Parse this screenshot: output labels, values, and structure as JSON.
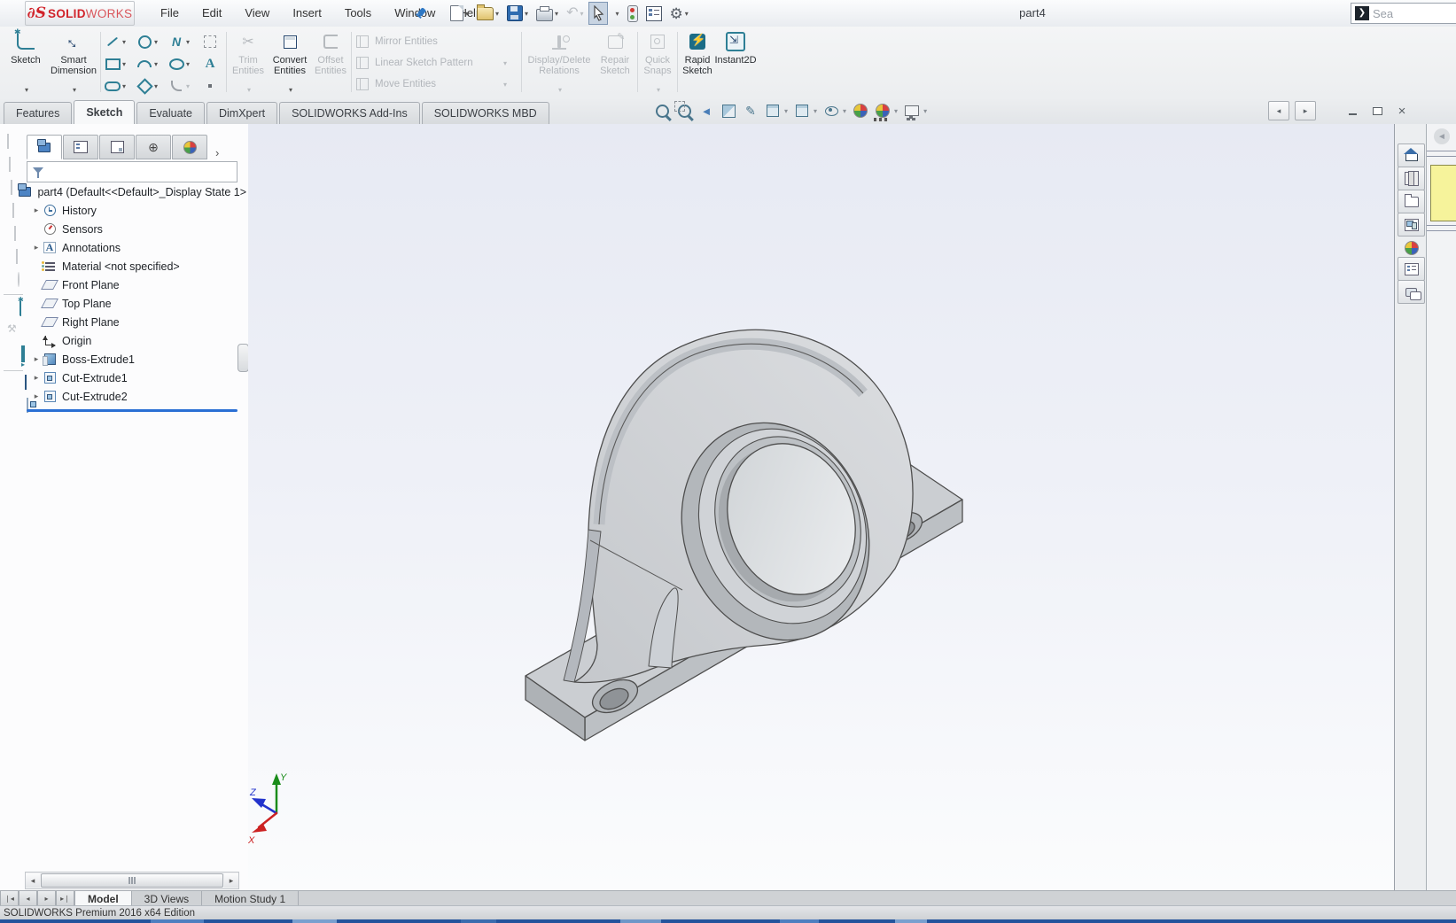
{
  "titlebar": {
    "logo": {
      "mark": "∂S",
      "solid": "SOLID",
      "works": "WORKS"
    },
    "menus": [
      "File",
      "Edit",
      "View",
      "Insert",
      "Tools",
      "Window",
      "Help"
    ],
    "document_title": "part4",
    "search_label": "Sea"
  },
  "ribbon": {
    "sketch": "Sketch",
    "smart_dimension": "Smart Dimension",
    "trim_entities": "Trim Entities",
    "convert_entities": "Convert Entities",
    "offset_entities": "Offset Entities",
    "mirror_entities": "Mirror Entities",
    "linear_sketch_pattern": "Linear Sketch Pattern",
    "move_entities": "Move Entities",
    "display_delete_relations": "Display/Delete Relations",
    "repair_sketch": "Repair Sketch",
    "quick_snaps": "Quick Snaps",
    "rapid_sketch": "Rapid Sketch",
    "instant2d": "Instant2D"
  },
  "command_tabs": {
    "tabs": [
      "Features",
      "Sketch",
      "Evaluate",
      "DimXpert",
      "SOLIDWORKS Add-Ins",
      "SOLIDWORKS MBD"
    ],
    "active_tab": "Sketch"
  },
  "feature_manager": {
    "root_label": "part4  (Default<<Default>_Display State 1>",
    "items": [
      {
        "label": "History",
        "expandable": true
      },
      {
        "label": "Sensors",
        "expandable": false
      },
      {
        "label": "Annotations",
        "expandable": true
      },
      {
        "label": "Material <not specified>",
        "expandable": false
      },
      {
        "label": "Front Plane",
        "expandable": false
      },
      {
        "label": "Top Plane",
        "expandable": false
      },
      {
        "label": "Right Plane",
        "expandable": false
      },
      {
        "label": "Origin",
        "expandable": false
      },
      {
        "label": "Boss-Extrude1",
        "expandable": true
      },
      {
        "label": "Cut-Extrude1",
        "expandable": true
      },
      {
        "label": "Cut-Extrude2",
        "expandable": true
      }
    ]
  },
  "viewport": {
    "triad_labels": {
      "x": "X",
      "y": "Y",
      "z": "Z"
    }
  },
  "bottom_tabs": {
    "tabs": [
      "Model",
      "3D Views",
      "Motion Study 1"
    ],
    "active_tab": "Model"
  },
  "status_bar": {
    "text": "SOLIDWORKS Premium 2016 x64 Edition"
  },
  "colors": {
    "brand_red": "#d1232a",
    "icon_teal": "#2e7f95",
    "icon_navy": "#27476e",
    "rollback_blue": "#2a6fd4",
    "viewport_top": "#e7eaf3",
    "viewport_bottom": "#fbfcfd",
    "part_gray": "#cbced2",
    "note_yellow": "#f6f39b",
    "taskbar_blue": "#24539c"
  }
}
